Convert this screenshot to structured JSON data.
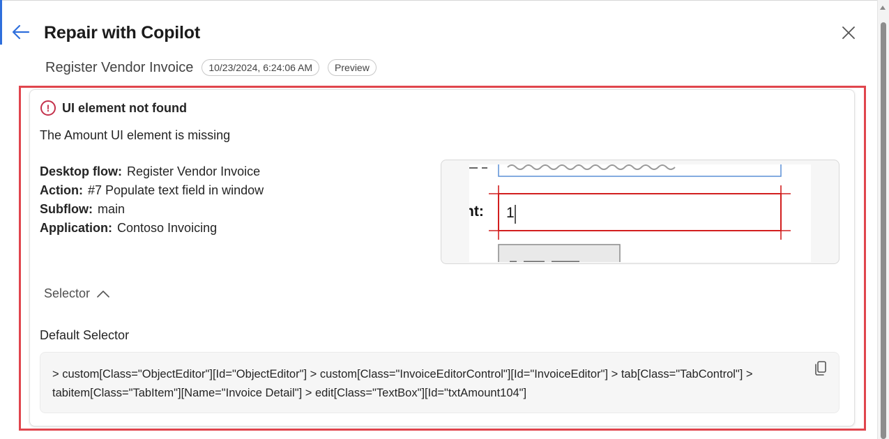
{
  "panel": {
    "title": "Repair with Copilot",
    "flow_name": "Register Vendor Invoice",
    "timestamp": "10/23/2024, 6:24:06 AM",
    "badge": "Preview"
  },
  "error": {
    "title": "UI element not found",
    "icon_text": "!",
    "description": "The Amount UI element is missing"
  },
  "details": [
    {
      "key": "Desktop flow:",
      "value": "Register Vendor Invoice"
    },
    {
      "key": "Action:",
      "value": "#7 Populate text field in window"
    },
    {
      "key": "Subflow:",
      "value": "main"
    },
    {
      "key": "Application:",
      "value": "Contoso Invoicing"
    }
  ],
  "screenshot": {
    "field_label": "nt:",
    "field_value": "1"
  },
  "selector": {
    "toggle_label": "Selector",
    "default_label": "Default Selector",
    "value": "> custom[Class=\"ObjectEditor\"][Id=\"ObjectEditor\"] > custom[Class=\"InvoiceEditorControl\"][Id=\"InvoiceEditor\"] > tab[Class=\"TabControl\"] > tabitem[Class=\"TabItem\"][Name=\"Invoice Detail\"] > edit[Class=\"TextBox\"][Id=\"txtAmount104\"]"
  },
  "colors": {
    "accent": "#2f6fdc",
    "error": "#c4314b",
    "highlight": "#e0454d",
    "target_outline": "#d21f1f"
  },
  "icons": [
    "back-arrow-icon",
    "close-icon",
    "error-circle-icon",
    "chevron-up-icon",
    "copy-icon"
  ]
}
